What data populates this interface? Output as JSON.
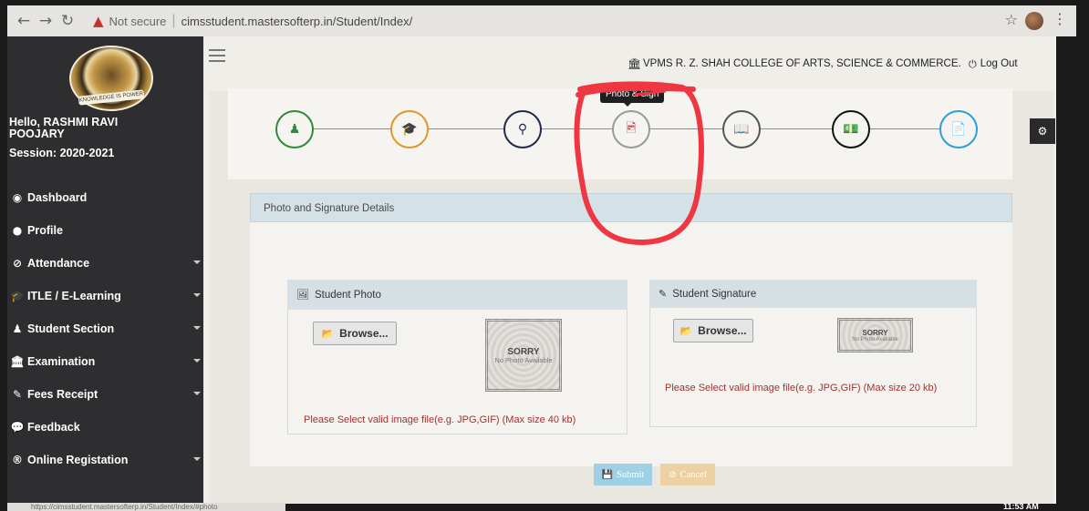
{
  "browser": {
    "security_label": "Not secure",
    "url": "cimsstudent.mastersofterp.in/Student/Index/",
    "status_url": "https://cimsstudent.mastersofterp.in/Student/Index/#photo",
    "clock": "11:53 AM"
  },
  "sidebar": {
    "greeting": "Hello, RASHMI RAVI POOJARY",
    "session": "Session: 2020-2021",
    "logo_text": "KNOWLEDGE IS POWER",
    "items": [
      {
        "label": "Dashboard",
        "icon": "dashboard-icon",
        "glyph": "◉"
      },
      {
        "label": "Profile",
        "icon": "user-circle-icon",
        "glyph": "●"
      },
      {
        "label": "Attendance",
        "icon": "clock-icon",
        "glyph": "⊘"
      },
      {
        "label": "ITLE / E-Learning",
        "icon": "graduation-cap-icon",
        "glyph": "🎓"
      },
      {
        "label": "Student Section",
        "icon": "user-icon",
        "glyph": "♟"
      },
      {
        "label": "Examination",
        "icon": "bank-icon",
        "glyph": "🏛"
      },
      {
        "label": "Fees Receipt",
        "icon": "pencil-icon",
        "glyph": "✎"
      },
      {
        "label": "Feedback",
        "icon": "chat-icon",
        "glyph": "💬"
      },
      {
        "label": "Online Registation",
        "icon": "registered-icon",
        "glyph": "®"
      }
    ]
  },
  "header": {
    "college_name": "VPMS R. Z. SHAH COLLEGE OF ARTS, SCIENCE & COMMERCE.",
    "logout_label": "Log Out"
  },
  "wizard": {
    "tooltip": "Photo & Sign",
    "steps": [
      {
        "icon": "user-icon",
        "glyph": "♟",
        "color": "#2f8a3a"
      },
      {
        "icon": "graduation-cap-icon",
        "glyph": "🎓",
        "color": "#e0962a"
      },
      {
        "icon": "map-marker-icon",
        "glyph": "⚲",
        "color": "#1f2a4a"
      },
      {
        "icon": "image-icon",
        "glyph": "🖻",
        "color": "#c53a3a"
      },
      {
        "icon": "book-icon",
        "glyph": "📖",
        "color": "#555555"
      },
      {
        "icon": "money-icon",
        "glyph": "💵",
        "color": "#111111"
      },
      {
        "icon": "file-icon",
        "glyph": "📄",
        "color": "#2d9ed8"
      }
    ]
  },
  "form": {
    "section_title": "Photo and Signature Details",
    "photo": {
      "title": "Student Photo",
      "browse": "Browse...",
      "sorry": "SORRY",
      "no_photo": "No Photo Available",
      "hint": "Please Select valid image file(e.g. JPG,GIF) (Max size 40 kb)"
    },
    "signature": {
      "title": "Student Signature",
      "browse": "Browse...",
      "sorry": "SORRY",
      "no_photo": "No Photo Available",
      "hint": "Please Select valid image file(e.g. JPG,GIF) (Max size 20 kb)"
    },
    "submit_label": "Submit",
    "cancel_label": "Cancel"
  }
}
